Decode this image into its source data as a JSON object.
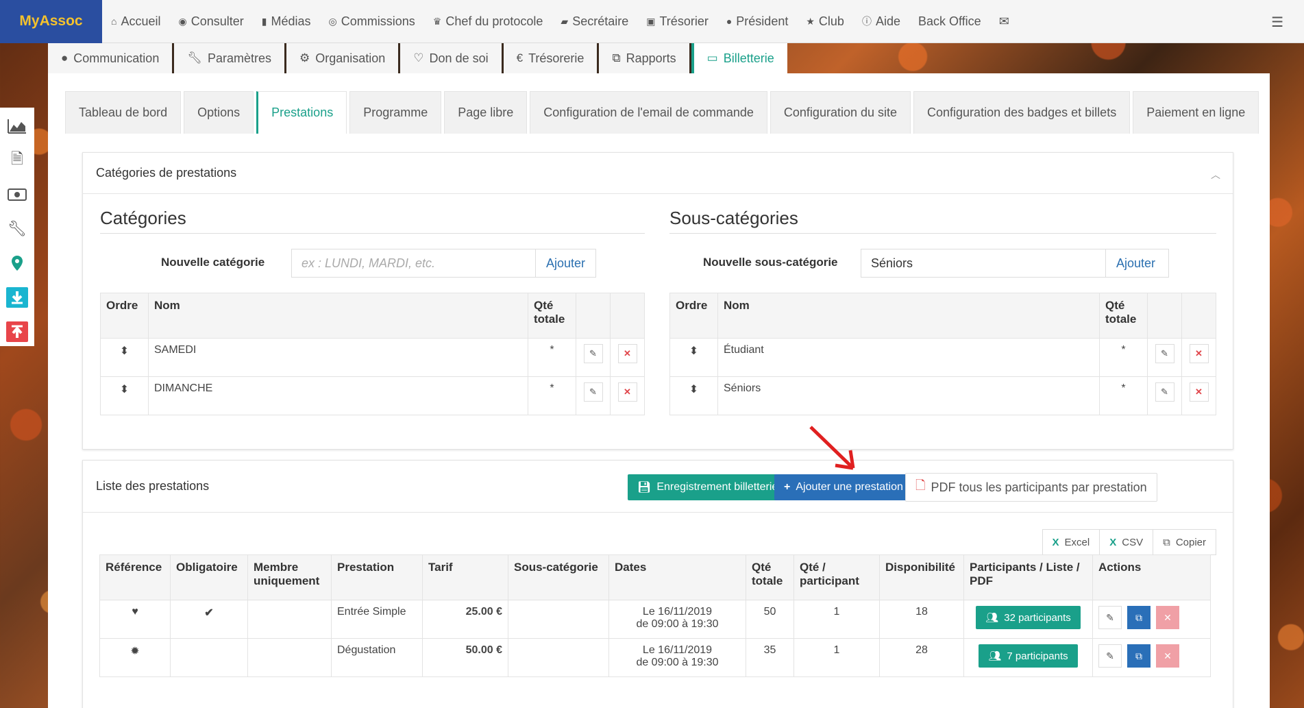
{
  "brand": {
    "logo": "MyAssoc"
  },
  "topnav": [
    {
      "label": "Accueil",
      "icon": "home-icon"
    },
    {
      "label": "Consulter",
      "icon": "eye-icon"
    },
    {
      "label": "Médias",
      "icon": "file-icon"
    },
    {
      "label": "Commissions",
      "icon": "user-circle-icon"
    },
    {
      "label": "Chef du protocole",
      "icon": "trophy-icon"
    },
    {
      "label": "Secrétaire",
      "icon": "book-icon"
    },
    {
      "label": "Trésorier",
      "icon": "money-icon"
    },
    {
      "label": "Président",
      "icon": "globe-icon"
    },
    {
      "label": "Club",
      "icon": "star-icon"
    },
    {
      "label": "Aide",
      "icon": "info-icon"
    },
    {
      "label": "Back Office",
      "icon": ""
    }
  ],
  "modtabs": [
    {
      "label": "Communication",
      "icon": "globe-icon"
    },
    {
      "label": "Paramètres",
      "icon": "wrench-icon"
    },
    {
      "label": "Organisation",
      "icon": "gears-icon"
    },
    {
      "label": "Don de soi",
      "icon": "heart-icon"
    },
    {
      "label": "Trésorerie",
      "icon": "euro-icon"
    },
    {
      "label": "Rapports",
      "icon": "copy-icon"
    },
    {
      "label": "Billetterie",
      "icon": "card-icon"
    }
  ],
  "subtabs": [
    "Tableau de bord",
    "Options",
    "Prestations",
    "Programme",
    "Page libre",
    "Configuration de l'email de commande",
    "Configuration du site",
    "Configuration des badges et billets",
    "Paiement en ligne"
  ],
  "categories_card": {
    "title": "Catégories de prestations",
    "cat": {
      "heading": "Catégories",
      "new_label": "Nouvelle catégorie",
      "placeholder": "ex : LUNDI, MARDI, etc.",
      "value": "",
      "add": "Ajouter",
      "headers": {
        "ordre": "Ordre",
        "nom": "Nom",
        "qte": "Qté totale"
      },
      "rows": [
        {
          "nom": "SAMEDI",
          "qte": "*"
        },
        {
          "nom": "DIMANCHE",
          "qte": "*"
        }
      ]
    },
    "subcat": {
      "heading": "Sous-catégories",
      "new_label": "Nouvelle sous-catégorie",
      "value": "Séniors",
      "add": "Ajouter",
      "headers": {
        "ordre": "Ordre",
        "nom": "Nom",
        "qte": "Qté totale"
      },
      "rows": [
        {
          "nom": "Étudiant",
          "qte": "*"
        },
        {
          "nom": "Séniors",
          "qte": "*"
        }
      ]
    }
  },
  "list_card": {
    "title": "Liste des prestations",
    "btn_save": "Enregistrement billetterie",
    "btn_add": "Ajouter une prestation",
    "btn_pdf": "PDF tous les participants par prestation",
    "export": {
      "excel": "Excel",
      "csv": "CSV",
      "copy": "Copier"
    },
    "headers": {
      "ref": "Référence",
      "oblig": "Obligatoire",
      "membre": "Membre uniquement",
      "prest": "Prestation",
      "tarif": "Tarif",
      "souscat": "Sous-catégorie",
      "dates": "Dates",
      "qte": "Qté totale",
      "qtep": "Qté / participant",
      "dispo": "Disponibilité",
      "participants": "Participants / Liste / PDF",
      "actions": "Actions"
    },
    "rows": [
      {
        "ref_icon": "heart-icon",
        "oblig": true,
        "prest": "Entrée Simple",
        "tarif": "25.00  €",
        "date1": "Le 16/11/2019",
        "date2": "de 09:00 à 19:30",
        "qte": "50",
        "qtep": "1",
        "dispo": "18",
        "participants": "32 participants"
      },
      {
        "ref_icon": "sun-icon",
        "oblig": false,
        "prest": "Dégustation",
        "tarif": "50.00  €",
        "date1": "Le 16/11/2019",
        "date2": "de 09:00 à 19:30",
        "qte": "35",
        "qtep": "1",
        "dispo": "28",
        "participants": "7 participants"
      }
    ]
  }
}
